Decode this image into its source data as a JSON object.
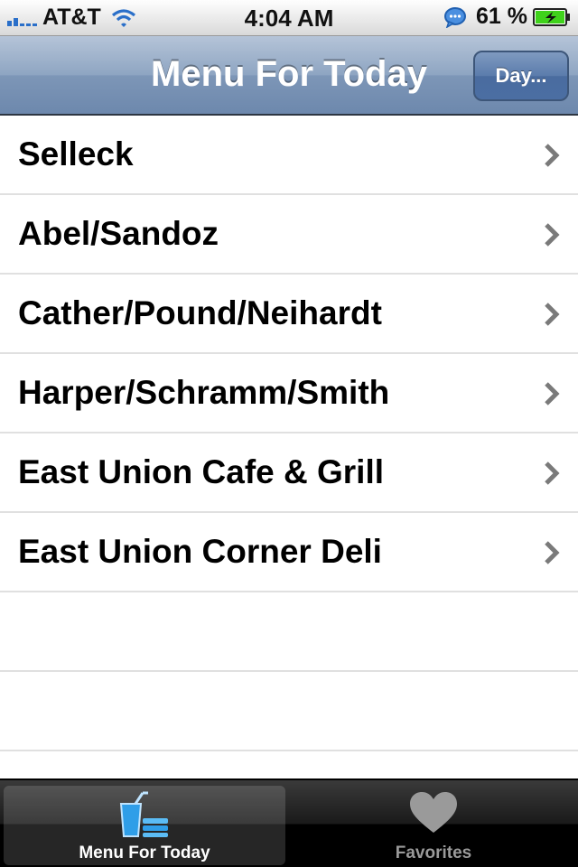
{
  "status_bar": {
    "carrier": "AT&T",
    "time": "4:04 AM",
    "battery_percent": "61 %"
  },
  "nav_bar": {
    "title": "Menu For Today",
    "right_button": "Day..."
  },
  "locations": [
    "Selleck",
    "Abel/Sandoz",
    "Cather/Pound/Neihardt",
    "Harper/Schramm/Smith",
    "East Union Cafe & Grill",
    "East Union Corner Deli"
  ],
  "tab_bar": {
    "tabs": [
      {
        "label": "Menu For Today",
        "icon": "drink-food-icon",
        "selected": true
      },
      {
        "label": "Favorites",
        "icon": "heart-icon",
        "selected": false
      }
    ]
  },
  "colors": {
    "nav_accent": "#6d88ad",
    "signal_blue": "#2a6fc9",
    "battery_green": "#3fd21b"
  }
}
